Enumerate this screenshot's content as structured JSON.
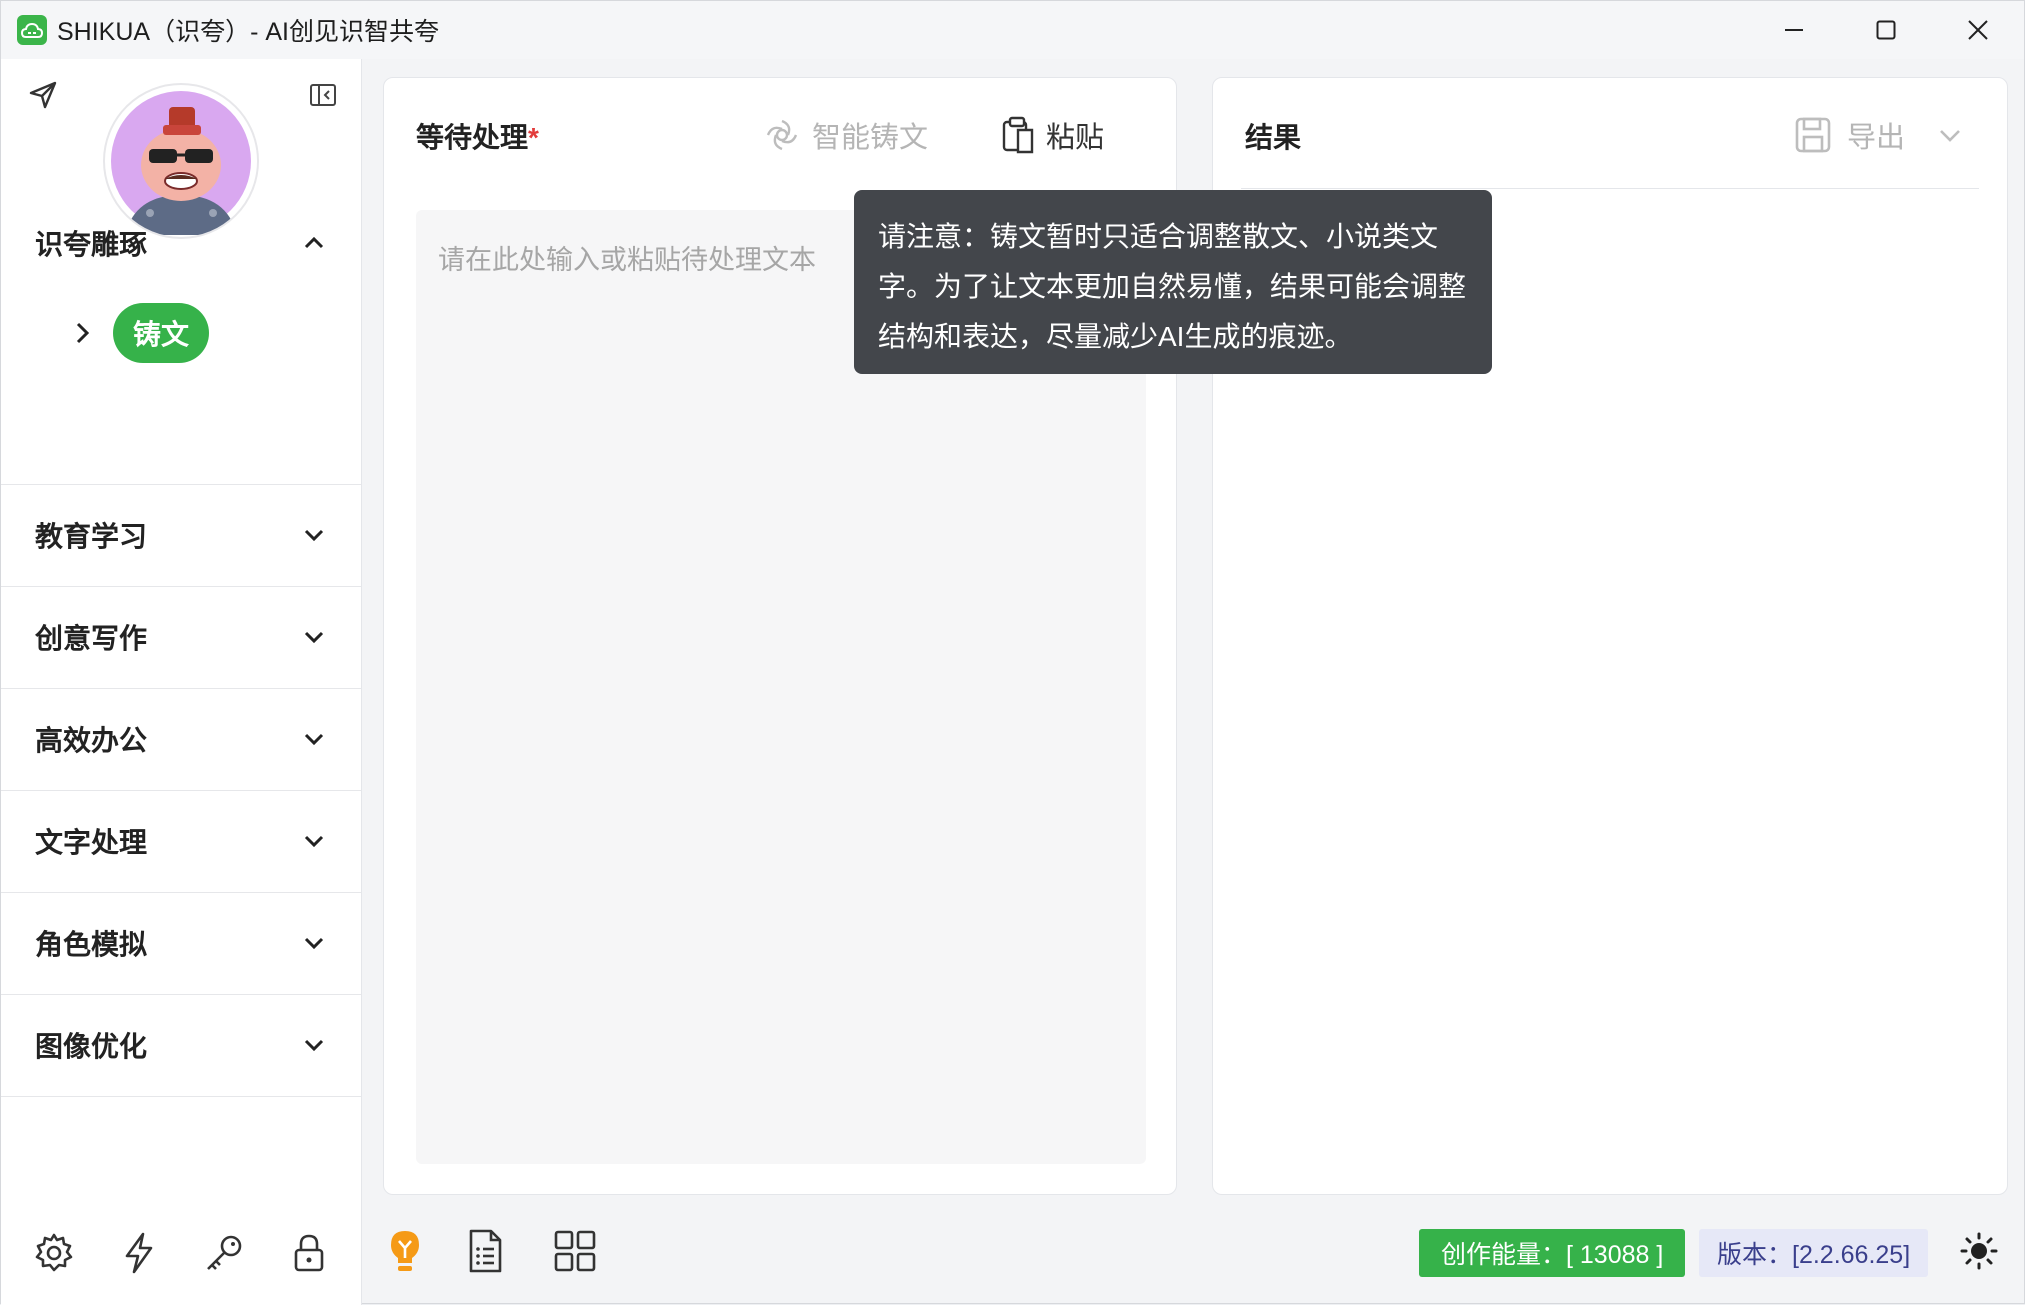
{
  "window": {
    "title": "SHIKUA（识夸）- AI创见识智共夸"
  },
  "sidebar": {
    "sections": [
      {
        "label": "识夸雕琢",
        "expanded": true,
        "items": [
          {
            "label": "铸文",
            "selected": true
          }
        ]
      },
      {
        "label": "教育学习",
        "expanded": false
      },
      {
        "label": "创意写作",
        "expanded": false
      },
      {
        "label": "高效办公",
        "expanded": false
      },
      {
        "label": "文字处理",
        "expanded": false
      },
      {
        "label": "角色模拟",
        "expanded": false
      },
      {
        "label": "图像优化",
        "expanded": false
      }
    ],
    "bottom_icons": [
      "gear-icon",
      "lightning-icon",
      "key-icon",
      "lock-icon"
    ]
  },
  "input_panel": {
    "title": "等待处理",
    "required_mark": "*",
    "smart_button_label": "智能铸文",
    "paste_button_label": "粘贴",
    "textarea_placeholder": "请在此处输入或粘贴待处理文本",
    "textarea_value": ""
  },
  "result_panel": {
    "title": "结果",
    "export_label": "导出"
  },
  "tooltip": {
    "text": "请注意：铸文暂时只适合调整散文、小说类文字。为了让文本更加自然易懂，结果可能会调整结构和表达，尽量减少AI生成的痕迹。"
  },
  "statusbar": {
    "energy_label": "创作能量：[ 13088 ]",
    "version_label": "版本：[2.2.66.25]"
  },
  "colors": {
    "accent_green": "#36b24a",
    "tooltip_bg": "#43464b",
    "version_bg": "#e6e8f7",
    "bulb_orange": "#f59a16"
  }
}
